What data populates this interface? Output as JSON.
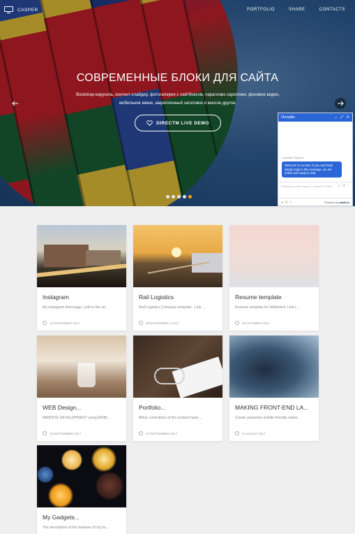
{
  "brand": {
    "name": "CASPER",
    "icon": "monitor-icon"
  },
  "nav": [
    {
      "label": "PORTFOLIO"
    },
    {
      "label": "SHARE"
    },
    {
      "label": "CONTACTS"
    }
  ],
  "hero": {
    "title": "СОВРЕМЕННЫЕ БЛОКИ ДЛЯ САЙТА",
    "subtitle": "Bootstrap-карусель, контент-слайдер, фотогалерея с лайтбоксом, параллакс-скроллинг, фоновое видео, мобильное меню, закрепленный заголовок и многое другое.",
    "cta": "DIRECTM LIVE DEMO",
    "slides": 5,
    "active_slide": 5
  },
  "chat": {
    "title": "Онлайн",
    "controls": [
      "⌄",
      "⤢",
      "✕"
    ],
    "agent": "Customer Support",
    "message": "Welcome to our site, if you need help simply reply to this message, we are online and ready to help.",
    "placeholder": "Напишите ответ здесь и нажмите 'Enter'",
    "powered_by": "Powered by",
    "powered_brand": "tawk.to",
    "accent": "#2b66d6"
  },
  "cards": [
    {
      "title": "Instagram",
      "desc": "My Instagram feed page.  Link to the sit...",
      "date": "23 NOVEMBER 2017"
    },
    {
      "title": "Rail Logistics",
      "desc": "Rail Logistics Company template . Link ...",
      "date": "09 NOVEMBER H 2017"
    },
    {
      "title": "Resume template",
      "desc": "Resume template for Mobirise4. Link t...",
      "date": "25 OCTOBER 2017"
    },
    {
      "title": "WEB Design...",
      "desc": "WEBSITE DEVELOPMENT using MOBI...",
      "date": "29 SEPTEMBER 2017"
    },
    {
      "title": "Portfolio...",
      "desc": "Minor corrections of the content have ...",
      "date": "27 SEPTEMBER 2017"
    },
    {
      "title": "MAKING FRONT-END LA...",
      "desc": "Create awesome mobile-friendly websi...",
      "date": "8 AUGUST 2017"
    },
    {
      "title": "My Gadgets...",
      "desc": "The description of the features of my fa...",
      "date": ""
    }
  ]
}
